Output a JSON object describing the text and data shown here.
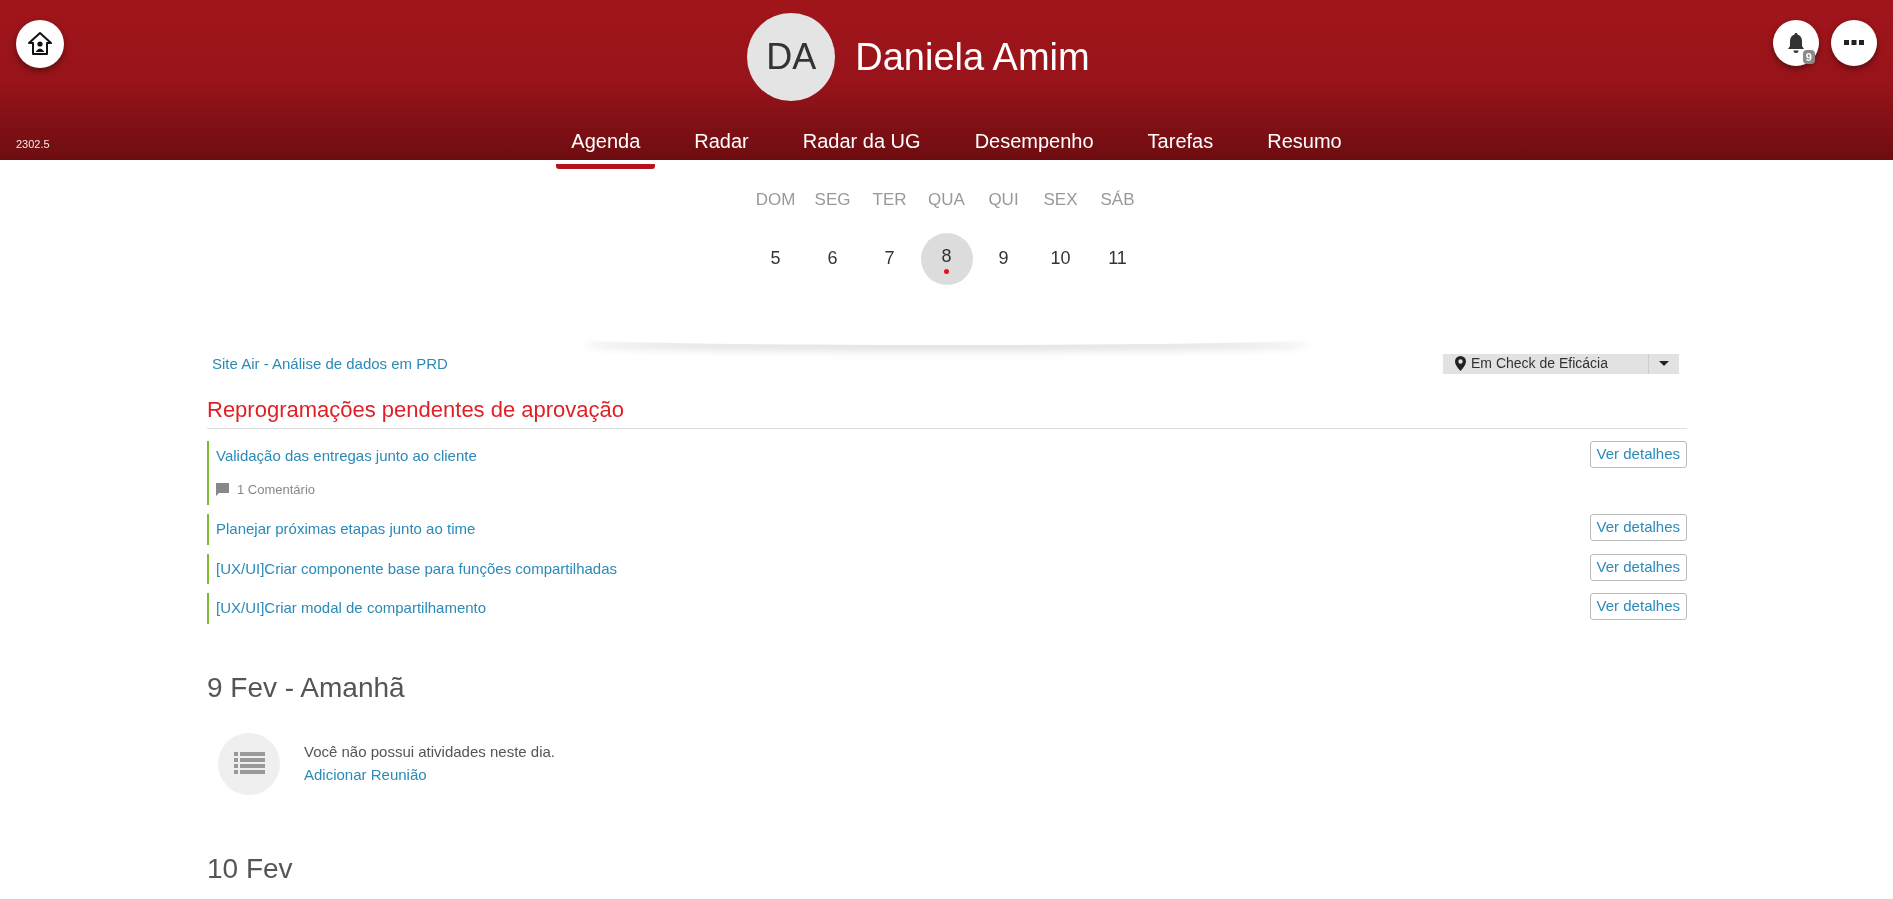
{
  "header": {
    "version": "2302.5",
    "initials": "DA",
    "name": "Daniela Amim",
    "notification_count": "9"
  },
  "tabs": [
    {
      "label": "Agenda",
      "selected": true
    },
    {
      "label": "Radar",
      "selected": false
    },
    {
      "label": "Radar da UG",
      "selected": false
    },
    {
      "label": "Desempenho",
      "selected": false
    },
    {
      "label": "Tarefas",
      "selected": false
    },
    {
      "label": "Resumo",
      "selected": false
    }
  ],
  "week": [
    {
      "weekday": "DOM",
      "day": "5",
      "selected": false,
      "has_event": false
    },
    {
      "weekday": "SEG",
      "day": "6",
      "selected": false,
      "has_event": false
    },
    {
      "weekday": "TER",
      "day": "7",
      "selected": false,
      "has_event": false
    },
    {
      "weekday": "QUA",
      "day": "8",
      "selected": true,
      "has_event": true
    },
    {
      "weekday": "QUI",
      "day": "9",
      "selected": false,
      "has_event": false
    },
    {
      "weekday": "SEX",
      "day": "10",
      "selected": false,
      "has_event": false
    },
    {
      "weekday": "SÁB",
      "day": "11",
      "selected": false,
      "has_event": false
    }
  ],
  "project": {
    "link": "Site Air - Análise de dados em PRD",
    "status": "Em Check de Eficácia"
  },
  "pending": {
    "heading": "Reprogramações pendentes de aprovação",
    "items": [
      {
        "title": "Validação das entregas junto ao cliente",
        "comments": "1 Comentário",
        "button": "Ver detalhes"
      },
      {
        "title": "Planejar próximas etapas junto ao time",
        "button": "Ver detalhes"
      },
      {
        "title": "[UX/UI]Criar componente base para funções compartilhadas",
        "button": "Ver detalhes"
      },
      {
        "title": "[UX/UI]Criar modal de compartilhamento",
        "button": "Ver detalhes"
      }
    ]
  },
  "days": [
    {
      "heading": "9 Fev - Amanhã",
      "empty_message": "Você não possui atividades neste dia.",
      "action": "Adicionar Reunião"
    },
    {
      "heading": "10 Fev"
    }
  ]
}
